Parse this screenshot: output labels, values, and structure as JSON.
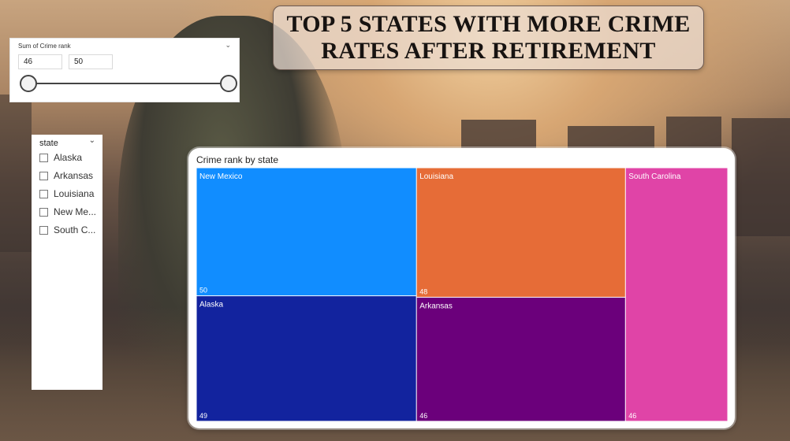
{
  "title": "TOP 5 STATES WITH MORE CRIME RATES AFTER RETIREMENT",
  "range_slicer": {
    "title": "Sum of Crime rank",
    "min_value": "46",
    "max_value": "50",
    "chevron_icon": "chevron-down-icon"
  },
  "state_slicer": {
    "title": "state",
    "chevron_icon": "chevron-down-icon",
    "items": [
      {
        "label": "Alaska",
        "checked": false
      },
      {
        "label": "Arkansas",
        "checked": false
      },
      {
        "label": "Louisiana",
        "checked": false
      },
      {
        "label": "New Me...",
        "checked": false
      },
      {
        "label": "South C...",
        "checked": false
      }
    ]
  },
  "treemap": {
    "title": "Crime rank by state"
  },
  "chart_data": {
    "type": "treemap",
    "title": "Crime rank by state",
    "items": [
      {
        "name": "New Mexico",
        "value": 50,
        "color": "#118dff"
      },
      {
        "name": "Alaska",
        "value": 49,
        "color": "#12239e"
      },
      {
        "name": "Louisiana",
        "value": 48,
        "color": "#e66c37"
      },
      {
        "name": "Arkansas",
        "value": 46,
        "color": "#6b007b"
      },
      {
        "name": "South Carolina",
        "value": 46,
        "color": "#e044a7"
      }
    ]
  }
}
